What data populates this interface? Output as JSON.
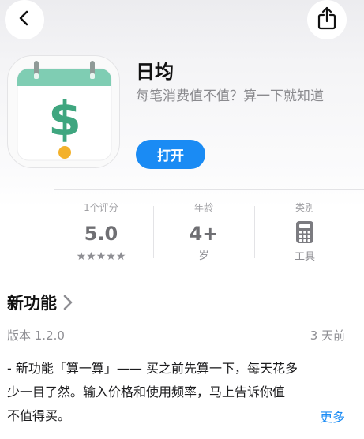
{
  "nav": {
    "back_icon": "chevron-left-icon",
    "share_icon": "share-icon"
  },
  "app": {
    "name": "日均",
    "subtitle": "每笔消费值不值？算一下就知道",
    "open_label": "打开",
    "icon": {
      "symbol": "$",
      "colors": {
        "band": "#7fcdb3",
        "symbol": "#3fa67f",
        "dot": "#f3b12b",
        "body": "#ffffff"
      }
    }
  },
  "info": {
    "ratings": {
      "caption": "1个评分",
      "value": "5.0",
      "stars": "★★★★★",
      "star_count": 5
    },
    "age": {
      "caption": "年龄",
      "value": "4+",
      "unit": "岁"
    },
    "category": {
      "caption": "类别",
      "icon": "calculator-icon",
      "value": "工具"
    }
  },
  "whats_new": {
    "title": "新功能",
    "chevron_icon": "chevron-right-icon",
    "version": "版本 1.2.0",
    "date": "3 天前",
    "notes_lines": [
      "- 新功能「算一算」—— 买之前先算一下，每天花多",
      "少一目了然。输入价格和使用频率，马上告诉你值",
      "不值得买。"
    ],
    "more_label": "更多"
  },
  "colors": {
    "accent": "#1a8bf4"
  }
}
